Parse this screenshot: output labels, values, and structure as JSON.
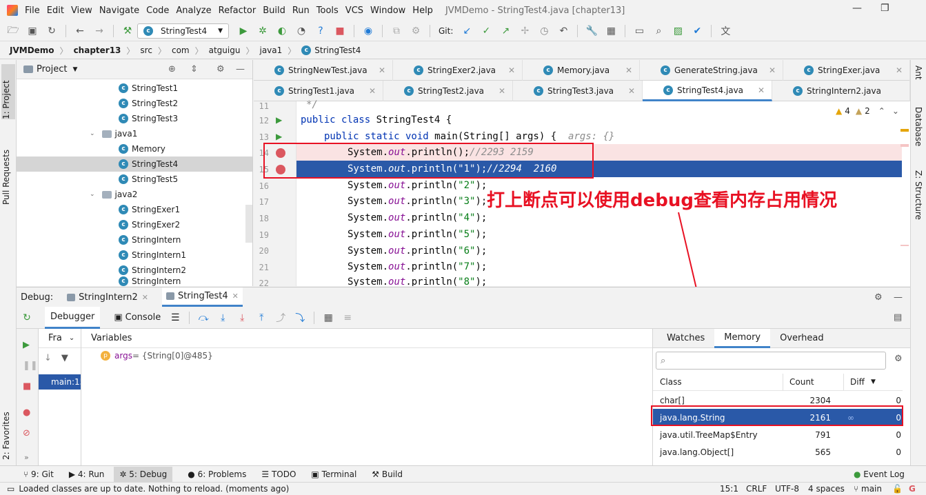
{
  "menubar": {
    "items": [
      "File",
      "Edit",
      "View",
      "Navigate",
      "Code",
      "Analyze",
      "Refactor",
      "Build",
      "Run",
      "Tools",
      "VCS",
      "Window",
      "Help"
    ],
    "title": "JVMDemo - StringTest4.java [chapter13]"
  },
  "toolbar": {
    "run_config": "StringTest4",
    "git_label": "Git:"
  },
  "breadcrumb": [
    "JVMDemo",
    "chapter13",
    "src",
    "com",
    "atguigu",
    "java1",
    "StringTest4"
  ],
  "left_strip": {
    "project": "1: Project",
    "pull_requests": "Pull Requests",
    "favorites": "2: Favorites"
  },
  "right_strip": {
    "ant": "Ant",
    "database": "Database",
    "structure": "Z: Structure"
  },
  "project": {
    "header": "Project",
    "rows": [
      {
        "label": "StringTest1",
        "kind": "class"
      },
      {
        "label": "StringTest2",
        "kind": "class"
      },
      {
        "label": "StringTest3",
        "kind": "class"
      },
      {
        "label": "java1",
        "kind": "folder"
      },
      {
        "label": "Memory",
        "kind": "class"
      },
      {
        "label": "StringTest4",
        "kind": "class",
        "selected": true
      },
      {
        "label": "StringTest5",
        "kind": "class"
      },
      {
        "label": "java2",
        "kind": "folder"
      },
      {
        "label": "StringExer1",
        "kind": "class"
      },
      {
        "label": "StringExer2",
        "kind": "class"
      },
      {
        "label": "StringIntern",
        "kind": "class"
      },
      {
        "label": "StringIntern1",
        "kind": "class"
      },
      {
        "label": "StringIntern2",
        "kind": "class"
      },
      {
        "label": "StringIntern",
        "kind": "class"
      }
    ]
  },
  "editor": {
    "tabs_row1": [
      "StringNewTest.java",
      "StringExer2.java",
      "Memory.java",
      "GenerateString.java",
      "StringExer.java"
    ],
    "tabs_row2": [
      "StringTest1.java",
      "StringTest2.java",
      "StringTest3.java",
      "StringTest4.java",
      "StringIntern2.java"
    ],
    "active_tab": "StringTest4.java",
    "warnings": "4",
    "weak_warnings": "2",
    "line_numbers": [
      "11",
      "12",
      "13",
      "14",
      "15",
      "16",
      "17",
      "18",
      "19",
      "20",
      "21",
      "22"
    ],
    "lines": {
      "l11": "*/",
      "l12_kw": "public class",
      "l12_rest": " StringTest4 {",
      "l13_kw": "public static void",
      "l13_rest": " main(String[] args) {",
      "l13_hint": "args: {}",
      "sys": "System.",
      "out": "out",
      "println": ".println(",
      "l14_end": ");",
      "l14_comment": "//2293 2159",
      "l15_str": "\"1\"",
      "l15_comment": "//2294  2160",
      "strings": [
        "\"2\"",
        "\"3\"",
        "\"4\"",
        "\"5\"",
        "\"6\"",
        "\"7\"",
        "\"8\""
      ]
    }
  },
  "annotation": "打上断点可以使用debug查看内存占用情况",
  "debug": {
    "label": "Debug:",
    "sessions": [
      "StringIntern2",
      "StringTest4"
    ],
    "tabs": {
      "debugger": "Debugger",
      "console": "Console"
    },
    "frames_header": "Fra",
    "frame": "main:15",
    "variables_header": "Variables",
    "var_badge": "p",
    "var_name": "args",
    "var_value": " = {String[0]@485}",
    "memory_tabs": [
      "Watches",
      "Memory",
      "Overhead"
    ],
    "memory_search_placeholder": "",
    "table_headers": {
      "class": "Class",
      "count": "Count",
      "diff": "Diff"
    },
    "rows": [
      {
        "class": "char[]",
        "count": "2304",
        "diff": "0"
      },
      {
        "class": "java.lang.String",
        "count": "2161",
        "diff": "0",
        "selected": true
      },
      {
        "class": "java.util.TreeMap$Entry",
        "count": "791",
        "diff": "0"
      },
      {
        "class": "java.lang.Object[]",
        "count": "565",
        "diff": "0"
      }
    ]
  },
  "bottom_tools": [
    "9: Git",
    "4: Run",
    "5: Debug",
    "6: Problems",
    "TODO",
    "Terminal",
    "Build",
    "Event Log"
  ],
  "status": {
    "message": "Loaded classes are up to date. Nothing to reload. (moments ago)",
    "position": "15:1",
    "line_sep": "CRLF",
    "encoding": "UTF-8",
    "indent": "4 spaces",
    "branch": "main"
  },
  "colors": {
    "selection": "#2a59a8",
    "accent": "#4083c9",
    "breakpoint": "#db5860",
    "annotation": "#e81123"
  }
}
